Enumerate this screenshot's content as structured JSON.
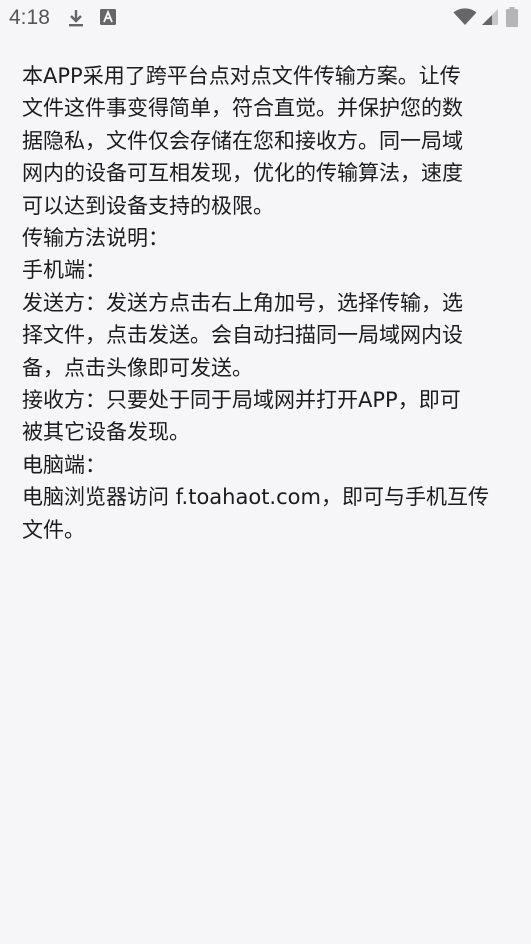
{
  "status_bar": {
    "time": "4:18",
    "icons": [
      "download-icon",
      "text-a-icon",
      "wifi-icon",
      "signal-icon",
      "battery-icon"
    ]
  },
  "content": {
    "lines": [
      "本APP采用了跨平台点对点文件传输方案。让传",
      "文件这件事变得简单，符合直觉。并保护您的数",
      "据隐私，文件仅会存储在您和接收方。同一局域",
      "网内的设备可互相发现，优化的传输算法，速度",
      "可以达到设备支持的极限。",
      "传输方法说明：",
      "手机端：",
      "发送方：发送方点击右上角加号，选择传输，选",
      "择文件，点击发送。会自动扫描同一局域网内设",
      "备，点击头像即可发送。",
      "接收方：只要处于同于局域网并打开APP，即可",
      "被其它设备发现。",
      "电脑端：",
      "电脑浏览器访问 f.toahaot.com，即可与手机互传",
      "文件。"
    ]
  }
}
